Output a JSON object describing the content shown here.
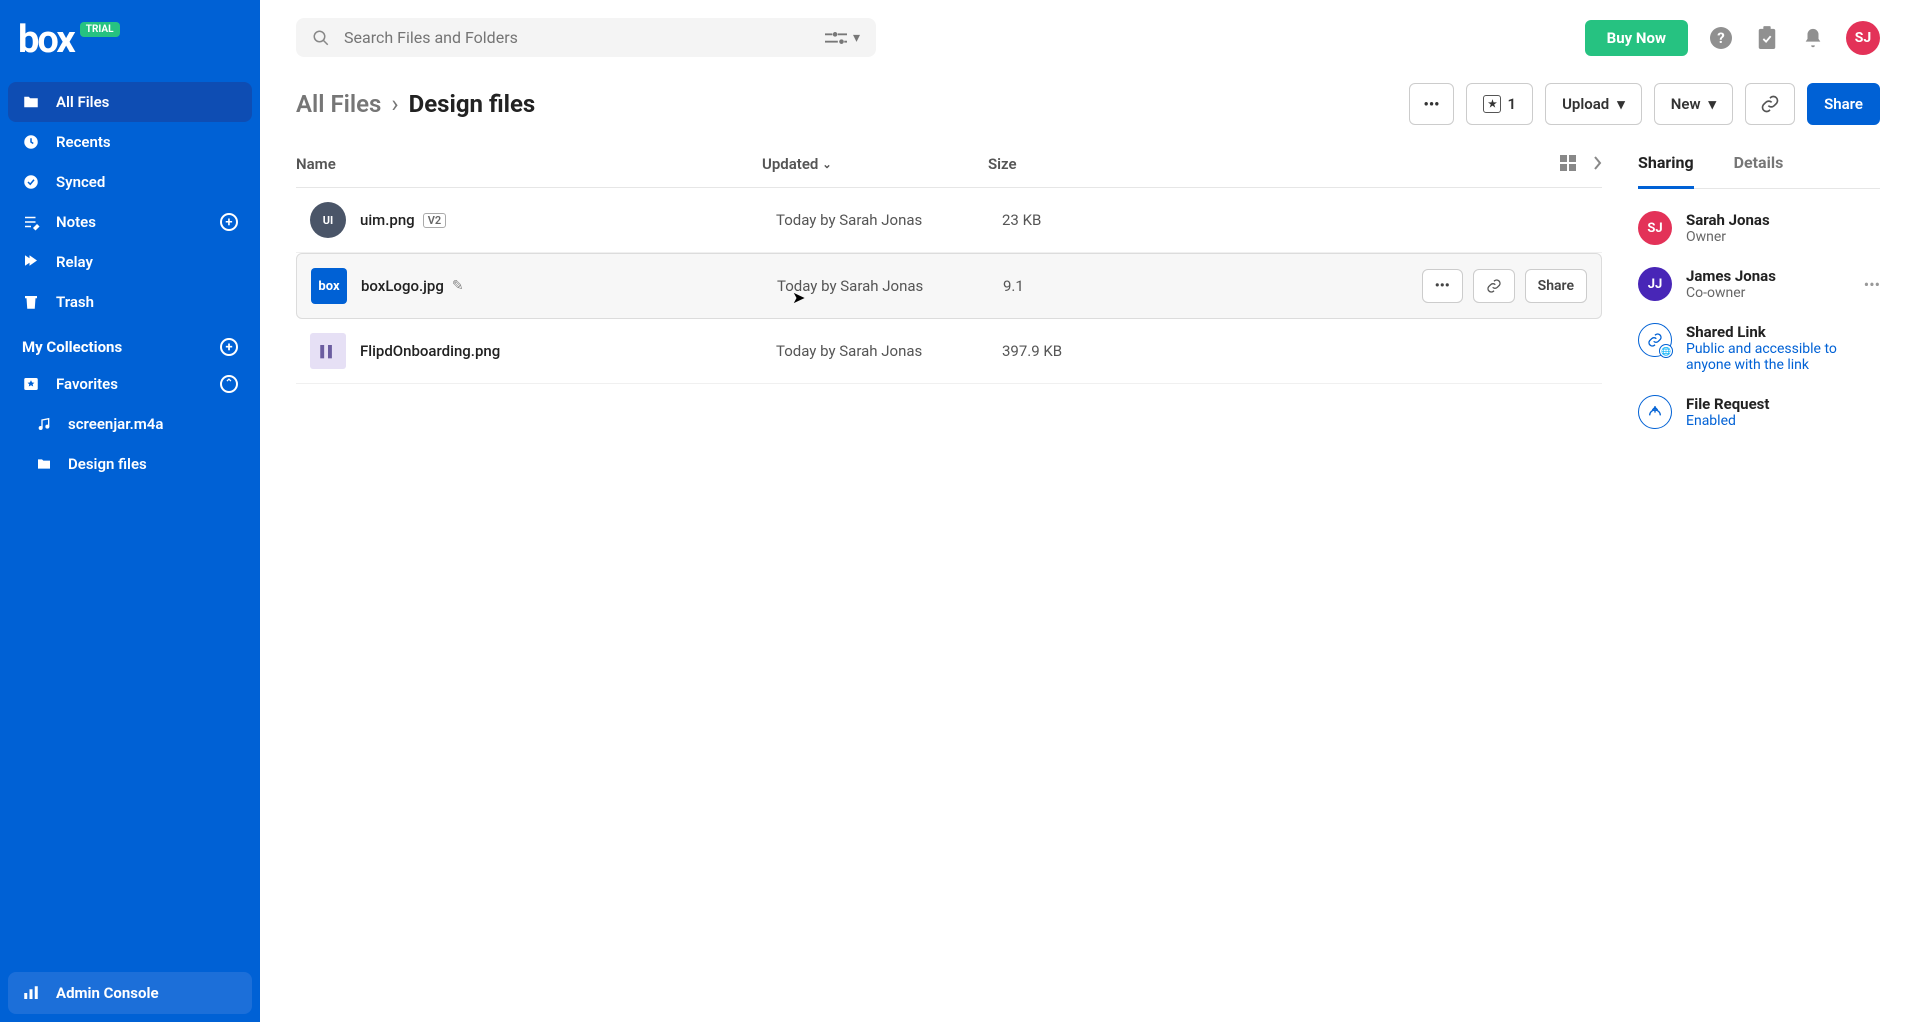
{
  "brand": {
    "name": "box",
    "badge": "TRIAL"
  },
  "sidebar": {
    "items": [
      {
        "label": "All Files"
      },
      {
        "label": "Recents"
      },
      {
        "label": "Synced"
      },
      {
        "label": "Notes"
      },
      {
        "label": "Relay"
      },
      {
        "label": "Trash"
      }
    ],
    "collections_label": "My Collections",
    "favorites_label": "Favorites",
    "favorites": [
      {
        "label": "screenjar.m4a"
      },
      {
        "label": "Design files"
      }
    ],
    "admin_label": "Admin Console"
  },
  "search": {
    "placeholder": "Search Files and Folders"
  },
  "topbar": {
    "buy_now": "Buy Now",
    "avatar_initials": "SJ"
  },
  "breadcrumb": {
    "root": "All Files",
    "current": "Design files"
  },
  "toolbar": {
    "fav_count": "1",
    "upload": "Upload",
    "new": "New",
    "share": "Share"
  },
  "columns": {
    "name": "Name",
    "updated": "Updated",
    "size": "Size"
  },
  "files": [
    {
      "name": "uim.png",
      "version": "V2",
      "updated": "Today by Sarah Jonas",
      "size": "23 KB"
    },
    {
      "name": "boxLogo.jpg",
      "updated": "Today by Sarah Jonas",
      "size": "9.1"
    },
    {
      "name": "FlipdOnboarding.png",
      "updated": "Today by Sarah Jonas",
      "size": "397.9 KB"
    }
  ],
  "row_actions": {
    "share": "Share"
  },
  "details": {
    "tabs": {
      "sharing": "Sharing",
      "details": "Details"
    },
    "people": [
      {
        "initials": "SJ",
        "name": "Sarah Jonas",
        "role": "Owner"
      },
      {
        "initials": "JJ",
        "name": "James Jonas",
        "role": "Co-owner"
      }
    ],
    "shared_link": {
      "title": "Shared Link",
      "desc": "Public and accessible to anyone with the link"
    },
    "file_request": {
      "title": "File Request",
      "status": "Enabled"
    }
  }
}
